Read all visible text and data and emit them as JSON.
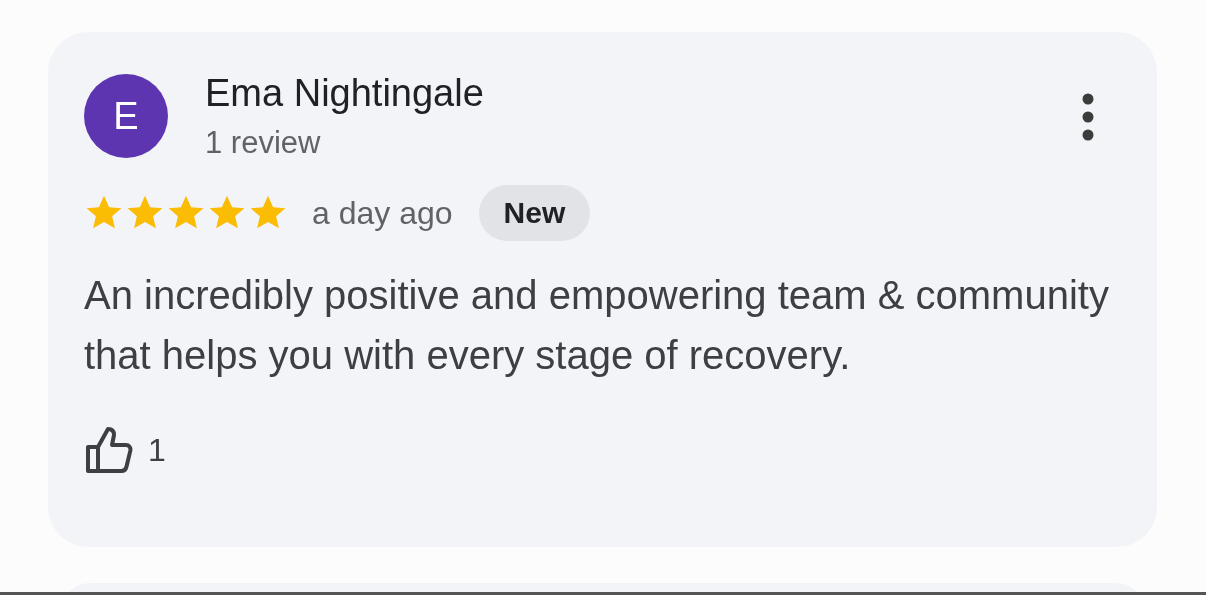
{
  "review": {
    "avatar_letter": "E",
    "author": "Ema Nightingale",
    "review_count": "1 review",
    "stars": 5,
    "time": "a day ago",
    "badge": "New",
    "text": "An incredibly positive and empowering team & community that helps you with every stage of recovery.",
    "likes": "1"
  }
}
